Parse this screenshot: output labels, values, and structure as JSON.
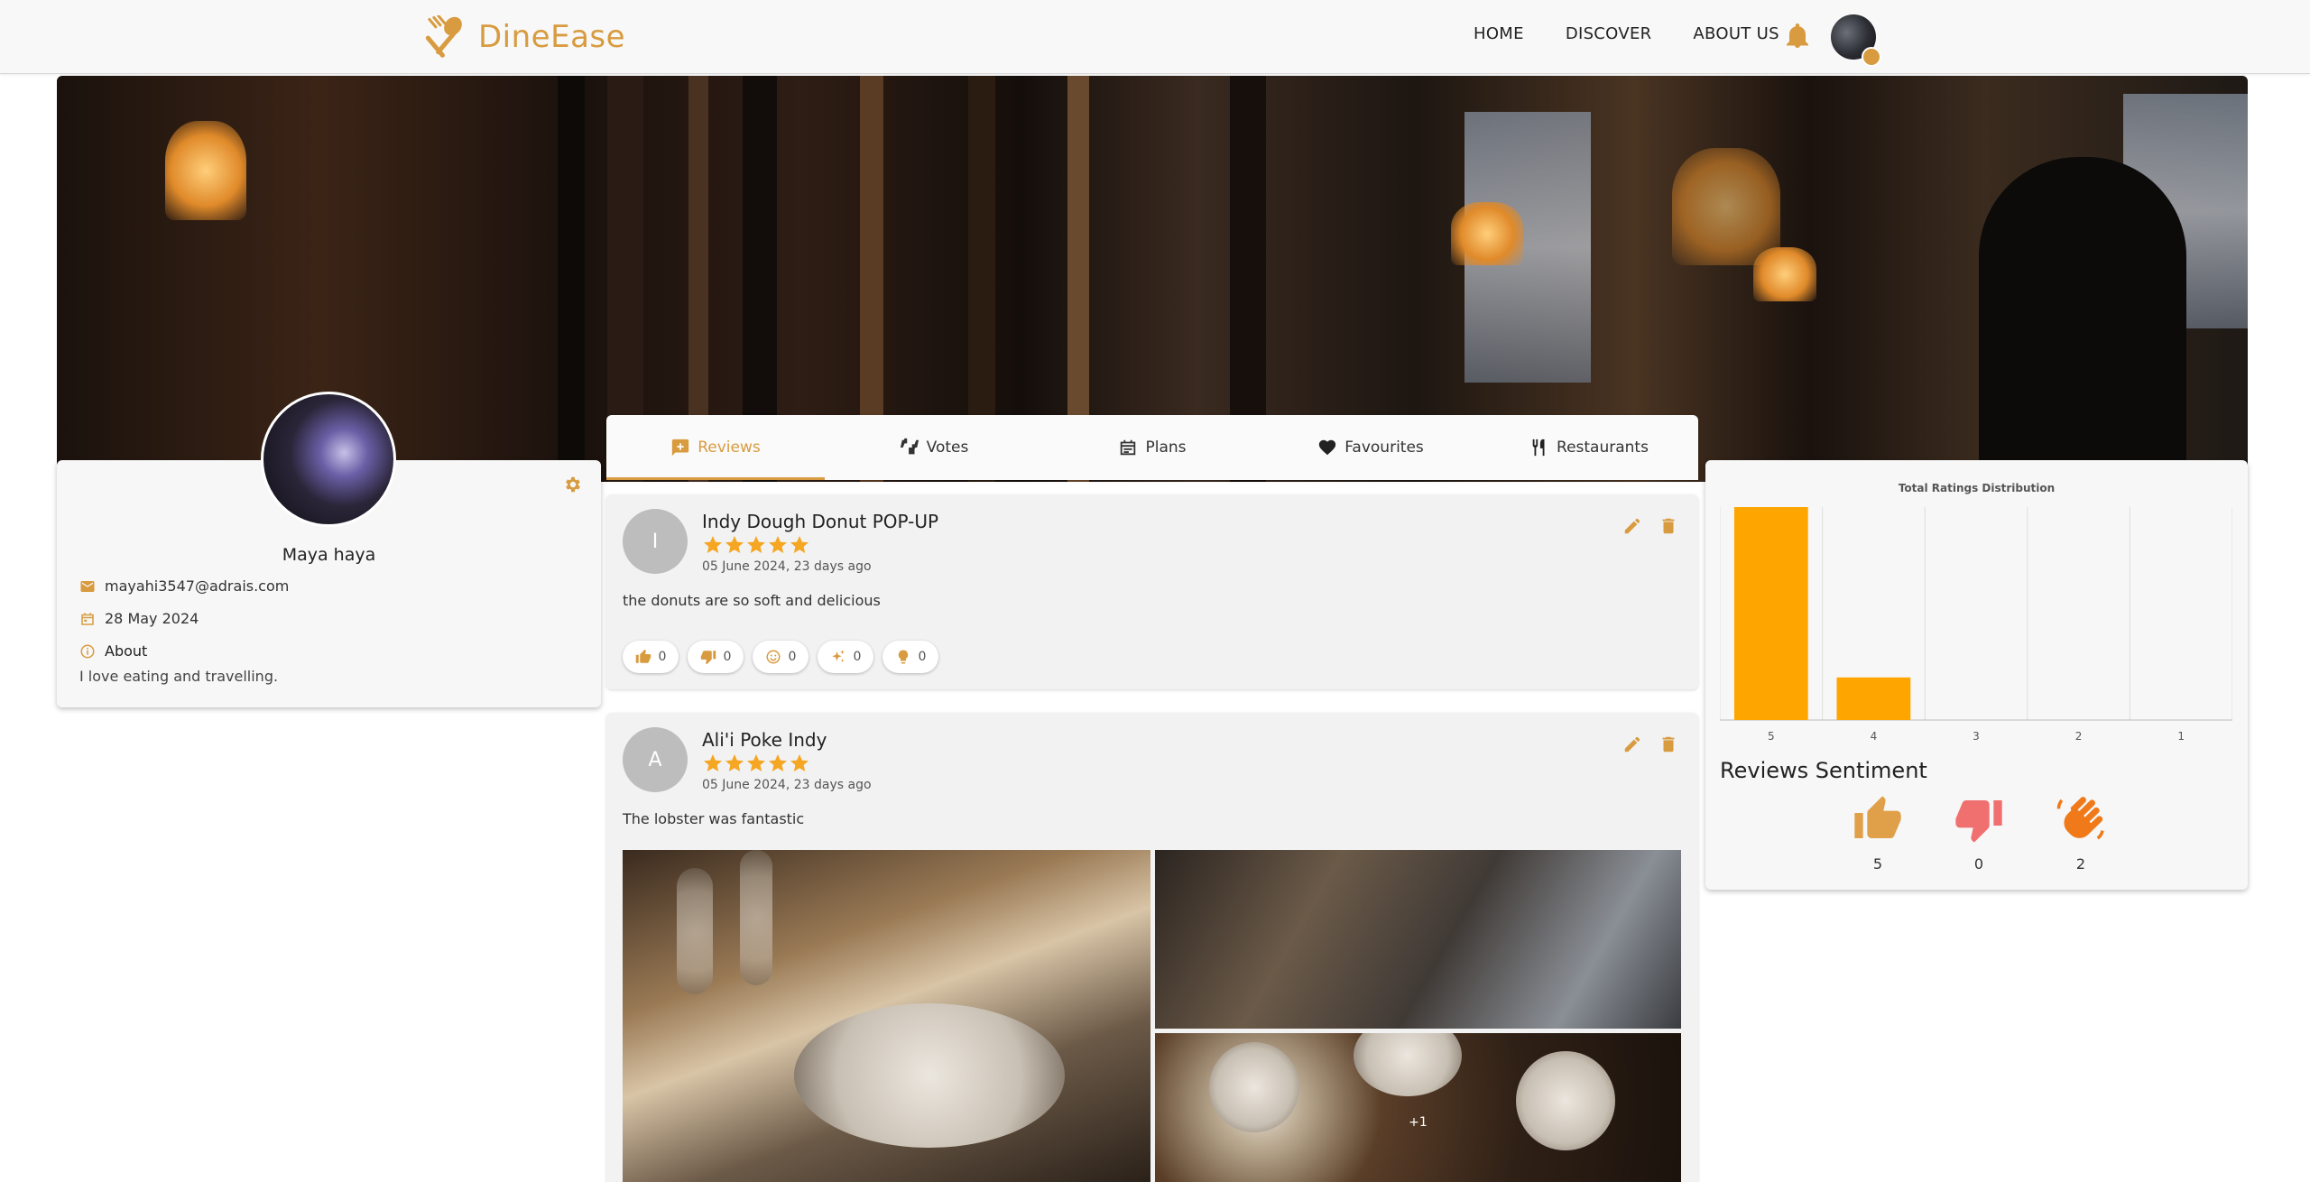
{
  "brand": {
    "name": "DineEase",
    "accent": "#d89b3f"
  },
  "nav": {
    "home": "HOME",
    "discover": "DISCOVER",
    "about": "ABOUT US"
  },
  "profile": {
    "name": "Maya haya",
    "email": "mayahi3547@adrais.com",
    "joined": "28 May 2024",
    "about_label": "About",
    "about_text": "I love eating and travelling."
  },
  "tabs": [
    {
      "label": "Reviews",
      "icon": "rate-review-icon",
      "active": true
    },
    {
      "label": "Votes",
      "icon": "thumbs-up-down-icon"
    },
    {
      "label": "Plans",
      "icon": "calendar-icon"
    },
    {
      "label": "Favourites",
      "icon": "heart-icon"
    },
    {
      "label": "Restaurants",
      "icon": "restaurant-icon"
    }
  ],
  "reviews": [
    {
      "initial": "I",
      "restaurant": "Indy Dough Donut POP-UP",
      "rating": 5,
      "date": "05 June 2024, 23 days ago",
      "text": "the donuts are so soft and delicious",
      "reactions": [
        {
          "icon": "thumb-up-icon",
          "count": "0"
        },
        {
          "icon": "thumb-down-icon",
          "count": "0"
        },
        {
          "icon": "smile-icon",
          "count": "0"
        },
        {
          "icon": "sparkle-icon",
          "count": "0"
        },
        {
          "icon": "lightbulb-icon",
          "count": "0"
        }
      ]
    },
    {
      "initial": "A",
      "restaurant": "Ali'i Poke Indy",
      "rating": 5,
      "date": "05 June 2024, 23 days ago",
      "text": "The lobster was fantastic",
      "more_photos": "+1"
    }
  ],
  "chart_data": {
    "type": "bar",
    "title": "Total Ratings Distribution",
    "categories": [
      "5",
      "4",
      "3",
      "2",
      "1"
    ],
    "values": [
      5,
      1,
      0,
      0,
      0
    ],
    "ylim": [
      0,
      5
    ],
    "color": "#ffa500",
    "grid": true
  },
  "sentiment": {
    "title": "Reviews Sentiment",
    "items": [
      {
        "icon": "thumb-up-icon",
        "count": "5",
        "color": "#e0a04a"
      },
      {
        "icon": "thumb-down-icon",
        "count": "0",
        "color": "#f07070"
      },
      {
        "icon": "waving-hand-icon",
        "count": "2",
        "color": "#f07a1a"
      }
    ]
  }
}
